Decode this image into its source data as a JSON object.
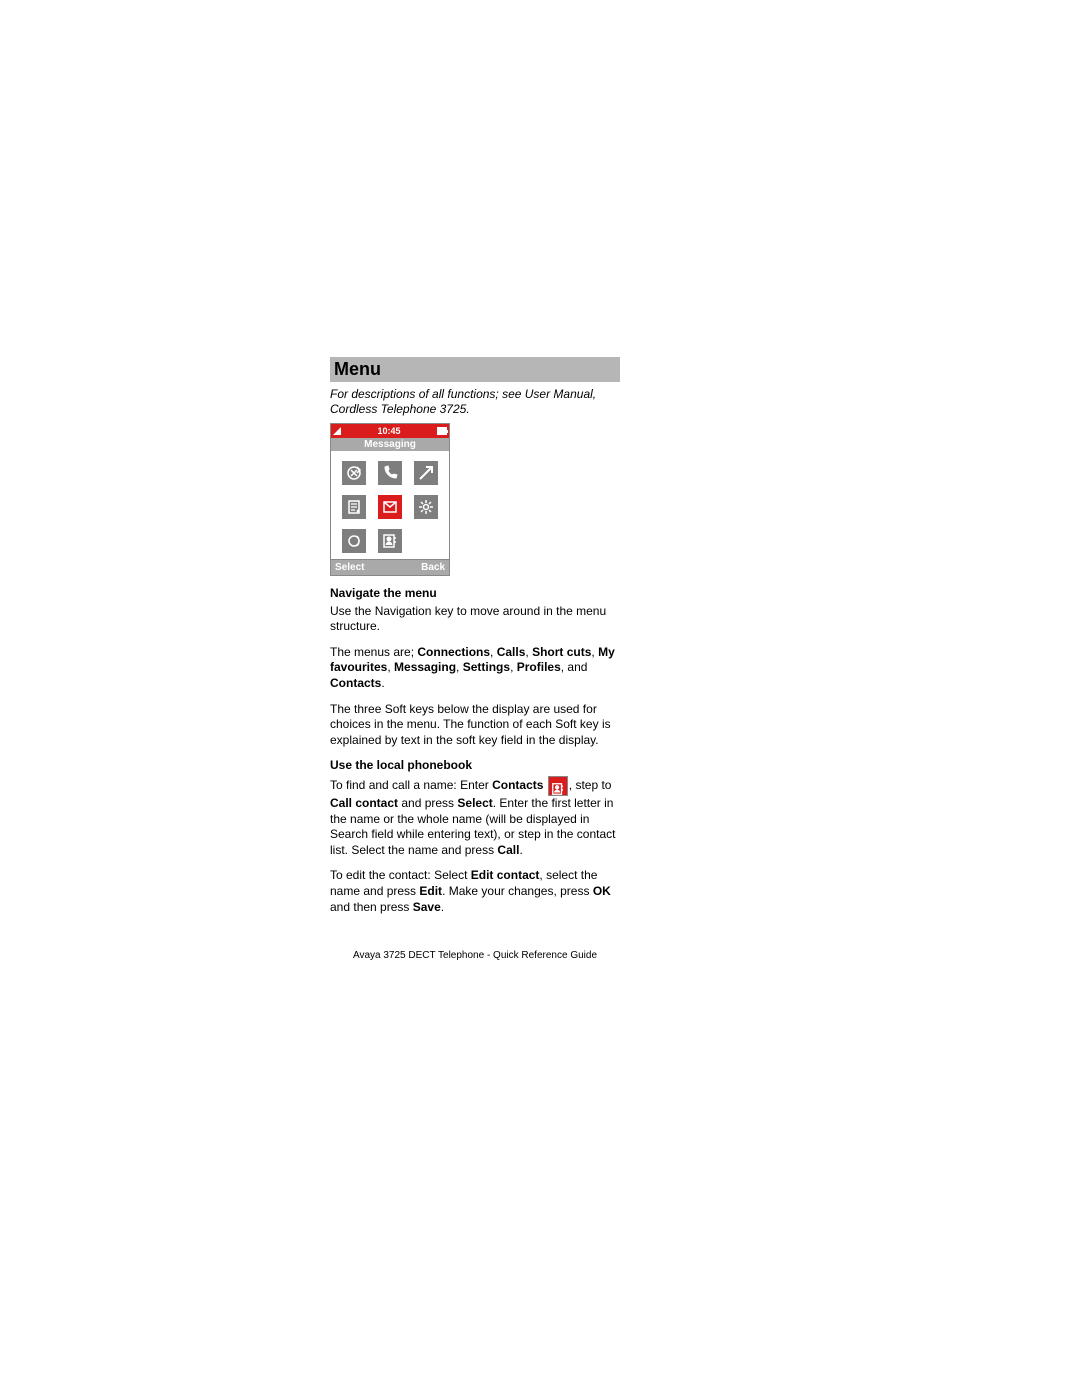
{
  "heading": "Menu",
  "intro": "For descriptions of all functions; see User Manual, Cordless Telephone 3725.",
  "phone": {
    "time": "10:45",
    "title": "Messaging",
    "softkeys": {
      "left": "Select",
      "right": "Back"
    }
  },
  "sections": {
    "nav": {
      "head": "Navigate the menu",
      "p1a": "Use the Navigation key to move around in the menu structure.",
      "p2a": "The menus are; ",
      "p2b": "Connections",
      "p2c": ", ",
      "p2d": "Calls",
      "p2e": ", ",
      "p2f": "Short cuts",
      "p2g": ", ",
      "p2h": "My favourites",
      "p2i": ", ",
      "p2j": "Messaging",
      "p2k": ", ",
      "p2l": "Settings",
      "p2m": ", ",
      "p2n": "Profiles",
      "p2o": ", and ",
      "p2p": "Contacts",
      "p2q": ".",
      "p3": "The three Soft keys below the display are used for choices in the menu. The function of each Soft key is explained by text in the soft key field in the display."
    },
    "pb": {
      "head": "Use the local phonebook",
      "p1a": "To find and call a name: Enter ",
      "p1b": "Contacts",
      "p1c": " ",
      "p1d": ", step to ",
      "p1e": "Call contact",
      "p1f": " and press ",
      "p1g": "Select",
      "p1h": ". Enter the first letter in the name or the whole name (will be displayed in Search field while entering text), or step in the contact list. Select the name and press ",
      "p1i": "Call",
      "p1j": ".",
      "p2a": "To edit the contact:  Select ",
      "p2b": "Edit contact",
      "p2c": ", select the name and press ",
      "p2d": "Edit",
      "p2e": ". Make your changes, press ",
      "p2f": "OK",
      "p2g": " and then press ",
      "p2h": "Save",
      "p2i": "."
    }
  },
  "footer": "Avaya 3725 DECT Telephone - Quick Reference Guide"
}
